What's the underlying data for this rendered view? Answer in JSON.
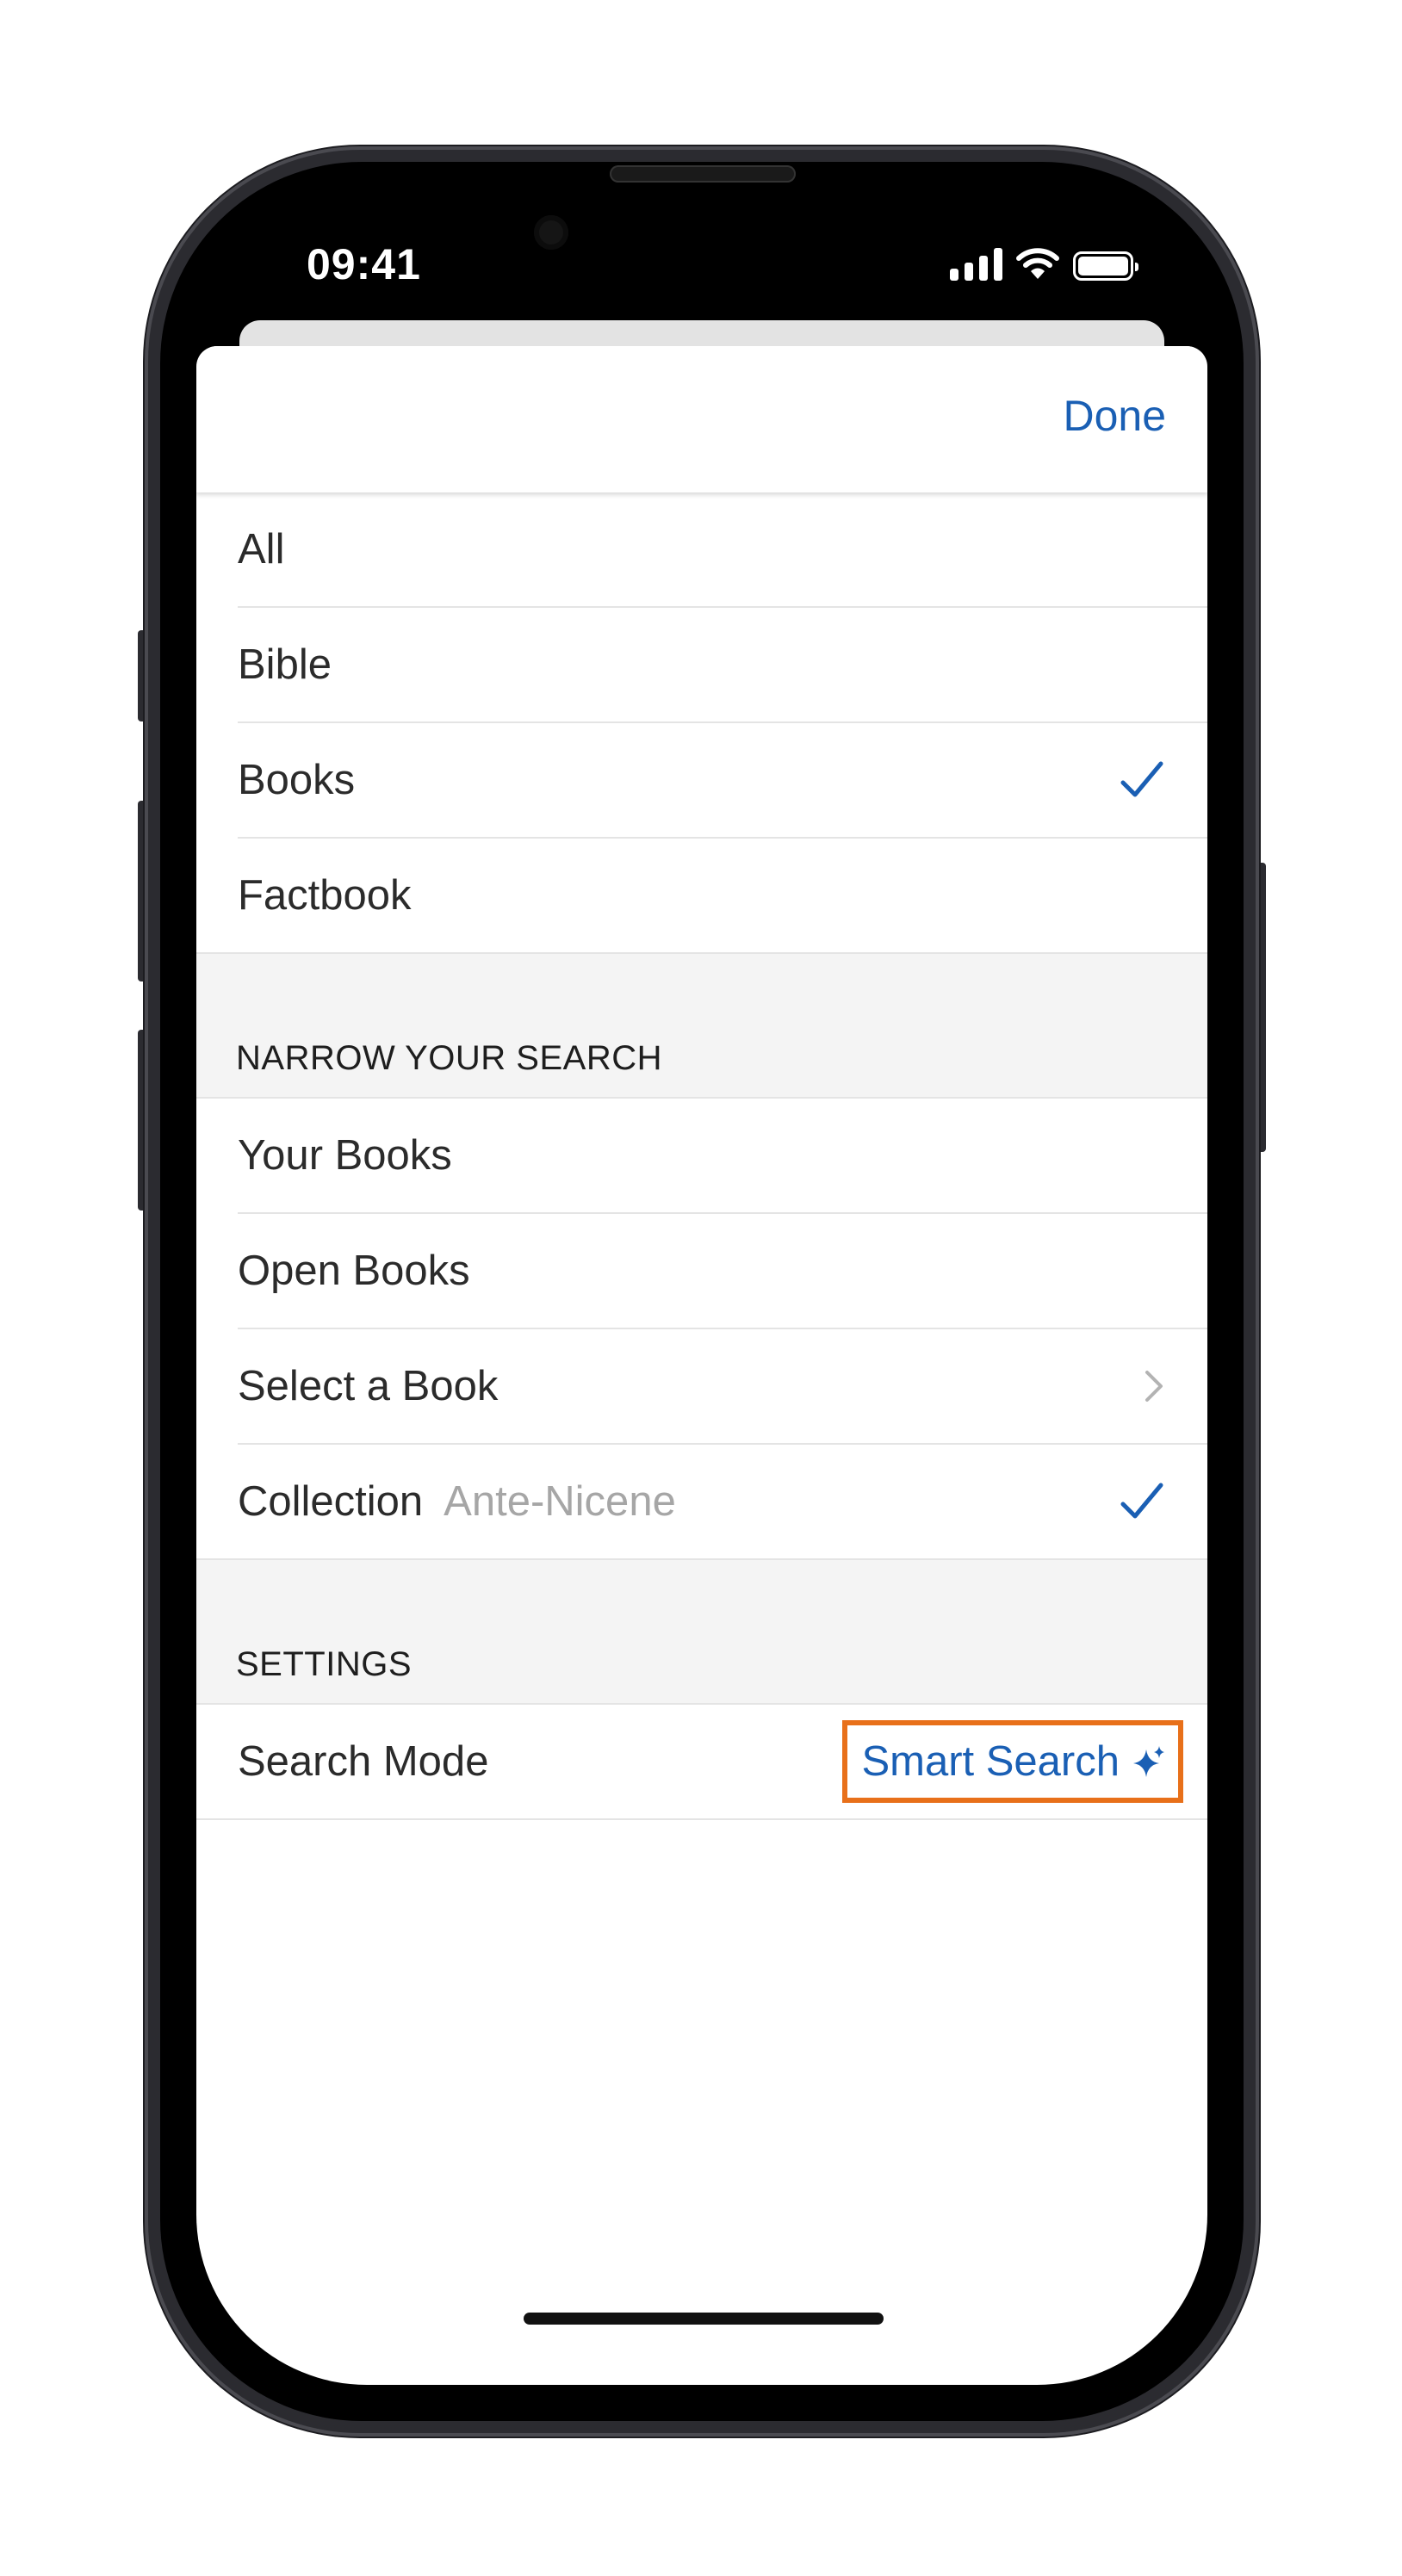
{
  "status_bar": {
    "time": "09:41"
  },
  "nav": {
    "done_label": "Done"
  },
  "scope_items": [
    {
      "label": "All",
      "checked": false
    },
    {
      "label": "Bible",
      "checked": false
    },
    {
      "label": "Books",
      "checked": true
    },
    {
      "label": "Factbook",
      "checked": false
    }
  ],
  "narrow_section": {
    "header": "NARROW YOUR SEARCH",
    "items": {
      "your_books": "Your Books",
      "open_books": "Open Books",
      "select_book": "Select a Book",
      "collection": "Collection",
      "collection_value": "Ante-Nicene"
    }
  },
  "settings_section": {
    "header": "SETTINGS",
    "search_mode_label": "Search Mode",
    "search_mode_value": "Smart Search"
  },
  "colors": {
    "accent": "#1a5fb4",
    "highlight": "#e8701a",
    "section_bg": "#f4f4f4"
  }
}
